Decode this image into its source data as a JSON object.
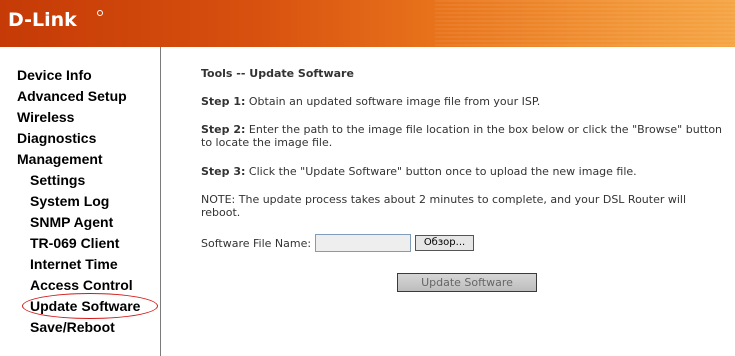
{
  "header": {
    "logo": "D-Link"
  },
  "sidebar": {
    "items": [
      {
        "label": "Device Info"
      },
      {
        "label": "Advanced Setup"
      },
      {
        "label": "Wireless"
      },
      {
        "label": "Diagnostics"
      },
      {
        "label": "Management"
      },
      {
        "label": "Settings"
      },
      {
        "label": "System Log"
      },
      {
        "label": "SNMP Agent"
      },
      {
        "label": "TR-069 Client"
      },
      {
        "label": "Internet Time"
      },
      {
        "label": "Access Control"
      },
      {
        "label": "Update Software"
      },
      {
        "label": "Save/Reboot"
      }
    ]
  },
  "main": {
    "title": "Tools -- Update Software",
    "step1_label": "Step 1:",
    "step1_text": " Obtain an updated software image file from your ISP.",
    "step2_label": "Step 2:",
    "step2_text": " Enter the path to the image file location in the box below or click the \"Browse\" button to locate the image file.",
    "step3_label": "Step 3:",
    "step3_text": " Click the \"Update Software\" button once to upload the new image file.",
    "note": "NOTE: The update process takes about 2 minutes to complete, and your DSL Router will reboot.",
    "file_label": "Software File Name:",
    "file_value": "",
    "browse_label": "Обзор...",
    "update_label": "Update Software"
  },
  "colors": {
    "highlight_ellipse": "#d21818",
    "header_start": "#c53a06",
    "header_end": "#f5a544"
  }
}
